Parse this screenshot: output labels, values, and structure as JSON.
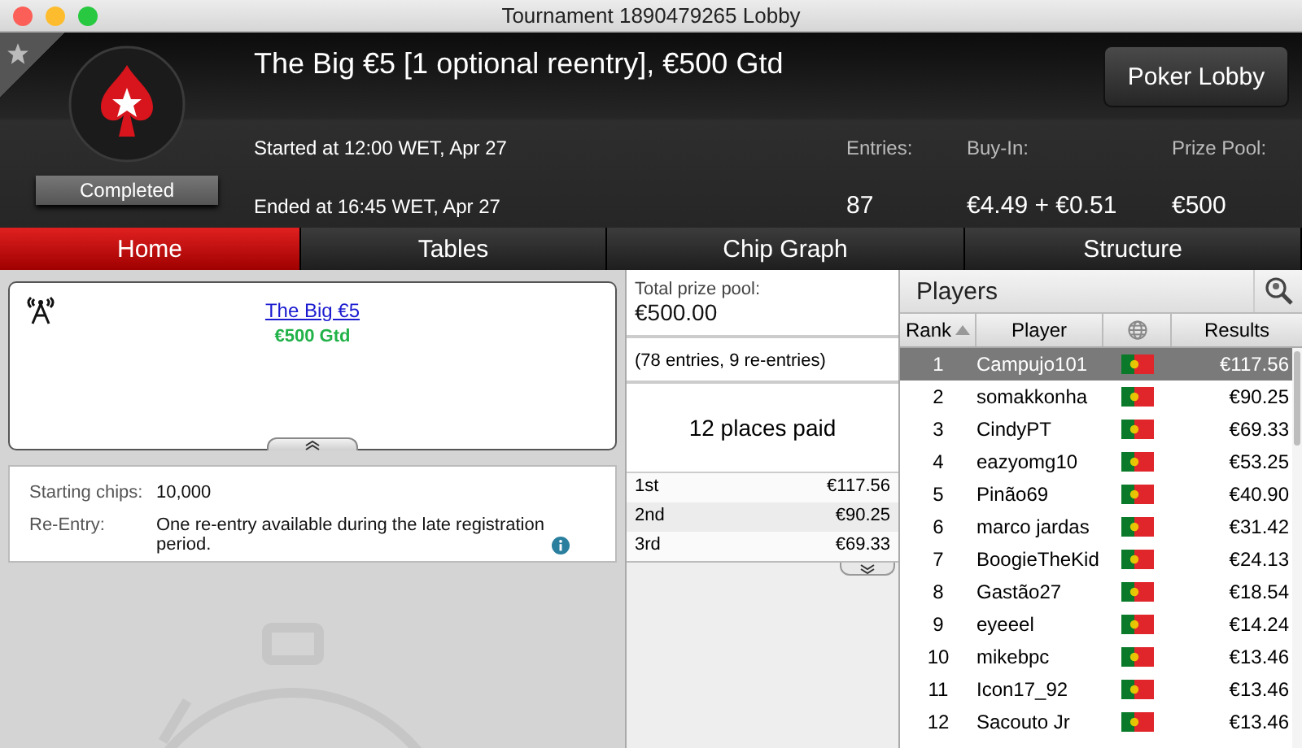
{
  "window": {
    "title": "Tournament 1890479265 Lobby"
  },
  "header": {
    "title": "The Big €5 [1 optional reentry], €500 Gtd",
    "status": "Completed",
    "started": "Started at 12:00 WET, Apr 27",
    "ended": "Ended at 16:45 WET, Apr 27",
    "lobby_button": "Poker Lobby",
    "stats": [
      {
        "label": "Entries:",
        "value": "87"
      },
      {
        "label": "Buy-In:",
        "value": "€4.49 + €0.51"
      },
      {
        "label": "Prize Pool:",
        "value": "€500"
      }
    ]
  },
  "tabs": [
    {
      "label": "Home",
      "selected": true
    },
    {
      "label": "Tables",
      "selected": false
    },
    {
      "label": "Chip Graph",
      "selected": false
    },
    {
      "label": "Structure",
      "selected": false
    }
  ],
  "home": {
    "card": {
      "link": "The Big €5",
      "guarantee": "€500 Gtd"
    },
    "details": [
      {
        "label": "Starting chips:",
        "value": "10,000",
        "info": false
      },
      {
        "label": "Re-Entry:",
        "value": "One re-entry available during the late registration period.",
        "info": true
      }
    ]
  },
  "prizes": {
    "total_label": "Total prize pool:",
    "total": "€500.00",
    "entries_note": "(78 entries, 9 re-entries)",
    "places_paid": "12 places paid",
    "places": [
      {
        "place": "1st",
        "amount": "€117.56"
      },
      {
        "place": "2nd",
        "amount": "€90.25"
      },
      {
        "place": "3rd",
        "amount": "€69.33"
      }
    ]
  },
  "players": {
    "title": "Players",
    "columns": {
      "rank": "Rank",
      "player": "Player",
      "results": "Results"
    },
    "rows": [
      {
        "rank": "1",
        "name": "Campujo101",
        "result": "€117.56",
        "selected": true
      },
      {
        "rank": "2",
        "name": "somakkonha",
        "result": "€90.25",
        "selected": false
      },
      {
        "rank": "3",
        "name": "CindyPT",
        "result": "€69.33",
        "selected": false
      },
      {
        "rank": "4",
        "name": "eazyomg10",
        "result": "€53.25",
        "selected": false
      },
      {
        "rank": "5",
        "name": "Pinão69",
        "result": "€40.90",
        "selected": false
      },
      {
        "rank": "6",
        "name": "marco jardas",
        "result": "€31.42",
        "selected": false
      },
      {
        "rank": "7",
        "name": "BoogieTheKid",
        "result": "€24.13",
        "selected": false
      },
      {
        "rank": "8",
        "name": "Gastão27",
        "result": "€18.54",
        "selected": false
      },
      {
        "rank": "9",
        "name": "eyeeel",
        "result": "€14.24",
        "selected": false
      },
      {
        "rank": "10",
        "name": "mikebpc",
        "result": "€13.46",
        "selected": false
      },
      {
        "rank": "11",
        "name": "Icon17_92",
        "result": "€13.46",
        "selected": false
      },
      {
        "rank": "12",
        "name": "Sacouto Jr",
        "result": "€13.46",
        "selected": false
      }
    ]
  }
}
